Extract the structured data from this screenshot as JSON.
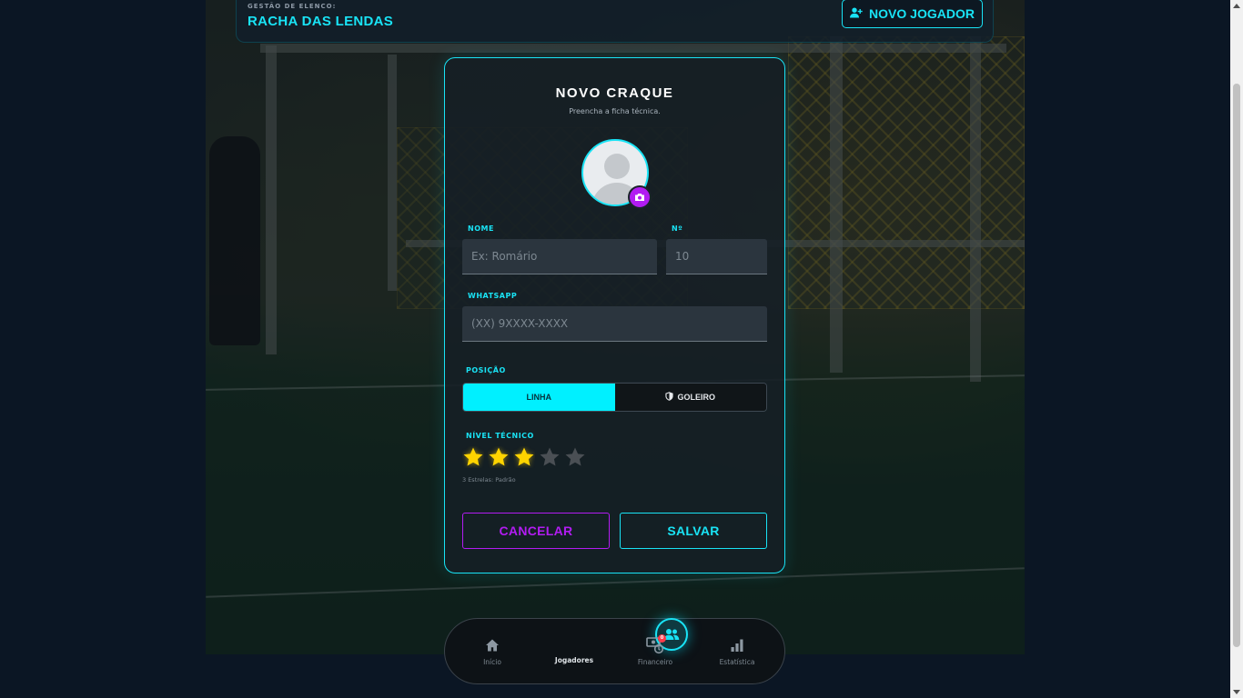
{
  "header": {
    "kicker": "GESTÃO DE ELENCO:",
    "team_name": "RACHA DAS LENDAS",
    "new_player_label": "NOVO JOGADOR"
  },
  "modal": {
    "title": "NOVO CRAQUE",
    "subtitle": "Preencha a ficha técnica.",
    "name_label": "NOME",
    "name_placeholder": "Ex: Romário",
    "number_label": "Nº",
    "number_placeholder": "10",
    "whatsapp_label": "WHATSAPP",
    "whatsapp_placeholder": "(XX) 9XXXX-XXXX",
    "position_label": "POSIÇÃO",
    "positions": [
      {
        "label": "LINHA",
        "selected": true
      },
      {
        "label": "GOLEIRO",
        "selected": false
      }
    ],
    "level_label": "NÍVEL TÉCNICO",
    "rating": 3,
    "rating_max": 5,
    "rating_hint": "3 Estrelas: Padrão",
    "cancel_label": "CANCELAR",
    "save_label": "SALVAR"
  },
  "nav": {
    "items": [
      {
        "label": "Início",
        "icon": "home-icon",
        "active": false
      },
      {
        "label": "Jogadores",
        "icon": "users-icon",
        "active": true
      },
      {
        "label": "Financeiro",
        "icon": "finance-icon",
        "active": false,
        "badge": "0"
      },
      {
        "label": "Estatística",
        "icon": "chart-icon",
        "active": false
      }
    ]
  },
  "colors": {
    "accent": "#19e3f5",
    "secondary": "#b21cf2",
    "star": "#ffd400",
    "badge": "#ff3b4a"
  }
}
